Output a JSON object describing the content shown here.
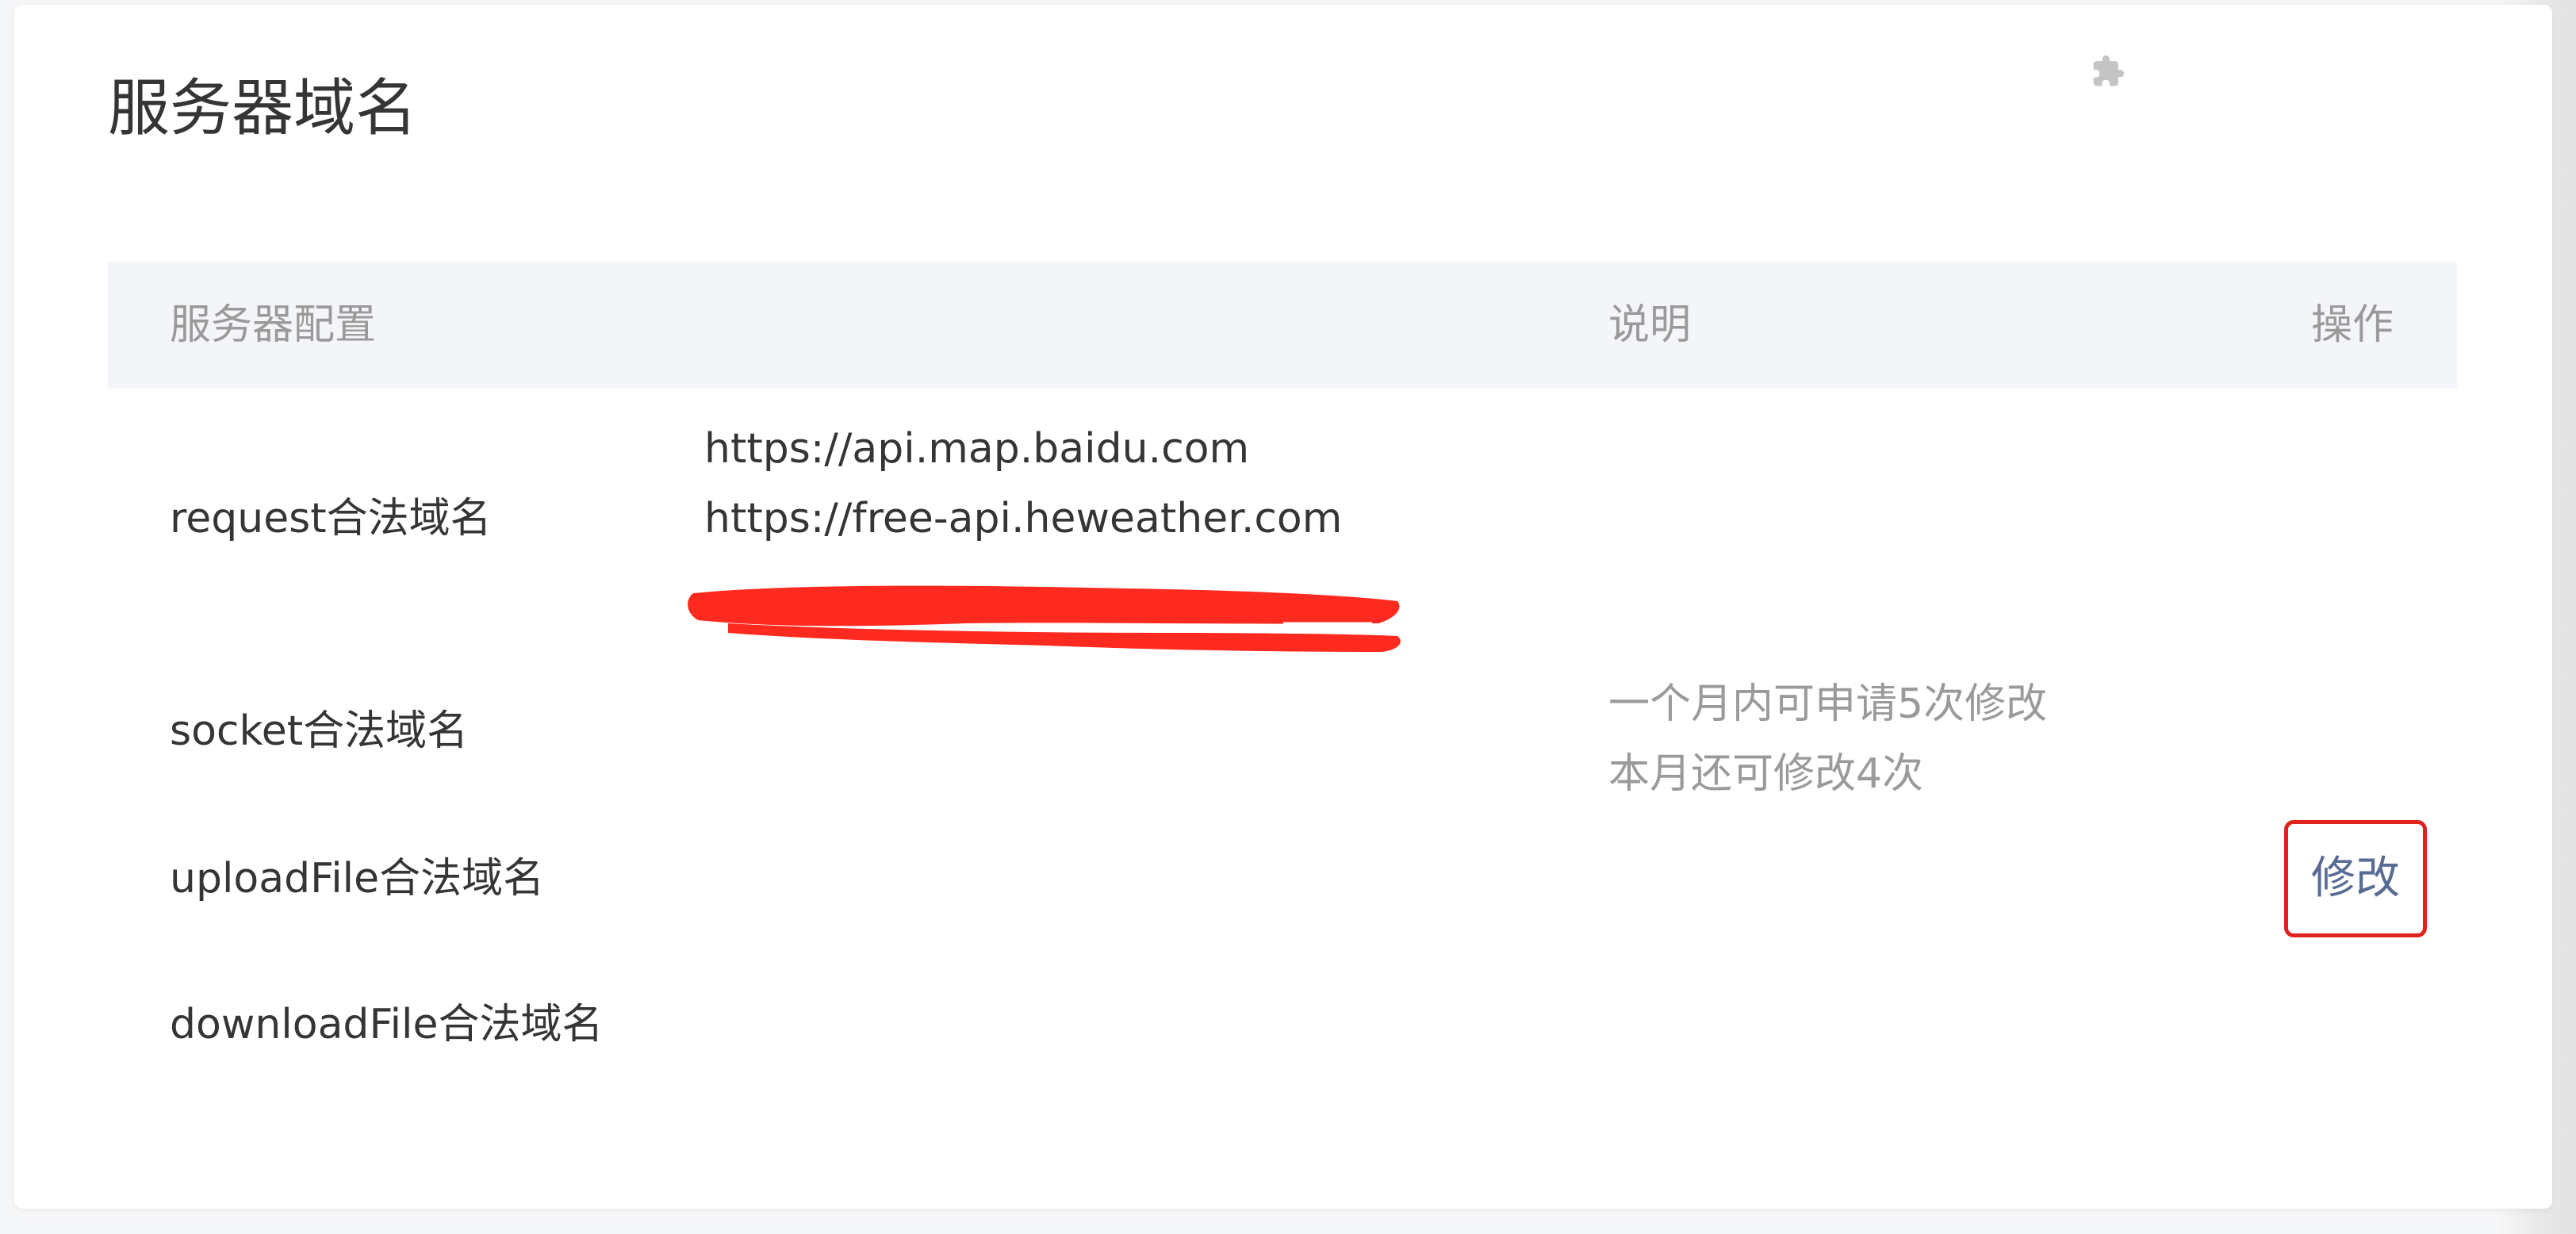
{
  "section": {
    "title": "服务器域名"
  },
  "icons": {
    "plugin": "puzzle-icon"
  },
  "table": {
    "headers": {
      "config": "服务器配置",
      "description": "说明",
      "operation": "操作"
    },
    "rows": [
      {
        "label": "request合法域名"
      },
      {
        "label": "socket合法域名"
      },
      {
        "label": "uploadFile合法域名"
      },
      {
        "label": "downloadFile合法域名"
      }
    ],
    "request_domains": [
      "https://api.map.baidu.com",
      "https://free-api.heweather.com"
    ],
    "description_lines": [
      "一个月内可申请5次修改",
      "本月还可修改4次"
    ],
    "edit_label": "修改"
  },
  "colors": {
    "link": "#576b95",
    "highlight_border": "#e0221e",
    "redaction": "#ff2a1f",
    "header_bg": "#f3f5f8"
  }
}
